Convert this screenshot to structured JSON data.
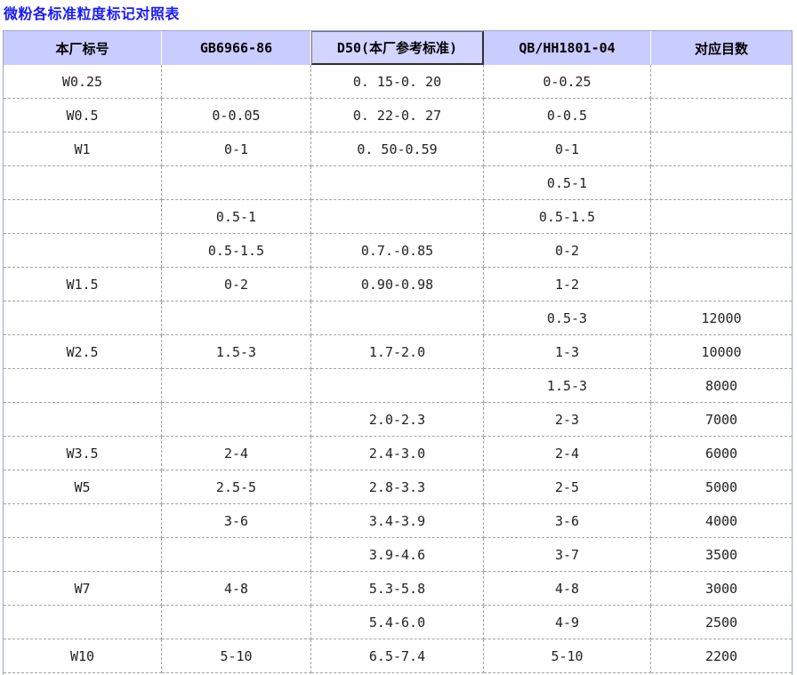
{
  "title": "微粉各标准粒度标记对照表",
  "columns": [
    "本厂标号",
    "GB6966-86",
    "D50(本厂参考标准)",
    "QB/HH1801-04",
    "对应目数"
  ],
  "rows": [
    [
      "W0.25",
      "",
      "0. 15-0. 20",
      "0-0.25",
      ""
    ],
    [
      "W0.5",
      "0-0.05",
      "0. 22-0. 27",
      "0-0.5",
      ""
    ],
    [
      "W1",
      "0-1",
      "0. 50-0.59",
      "0-1",
      ""
    ],
    [
      "",
      "",
      "",
      "0.5-1",
      ""
    ],
    [
      "",
      "0.5-1",
      "",
      "0.5-1.5",
      ""
    ],
    [
      "",
      "0.5-1.5",
      "0.7.-0.85",
      "0-2",
      ""
    ],
    [
      "W1.5",
      "0-2",
      "0.90-0.98",
      "1-2",
      ""
    ],
    [
      "",
      "",
      "",
      "0.5-3",
      "12000"
    ],
    [
      "W2.5",
      "1.5-3",
      "1.7-2.0",
      "1-3",
      "10000"
    ],
    [
      "",
      "",
      "",
      "1.5-3",
      "8000"
    ],
    [
      "",
      "",
      "2.0-2.3",
      "2-3",
      "7000"
    ],
    [
      "W3.5",
      "2-4",
      "2.4-3.0",
      "2-4",
      "6000"
    ],
    [
      "W5",
      "2.5-5",
      "2.8-3.3",
      "2-5",
      "5000"
    ],
    [
      "",
      "3-6",
      "3.4-3.9",
      "3-6",
      "4000"
    ],
    [
      "",
      "",
      "3.9-4.6",
      "3-7",
      "3500"
    ],
    [
      "W7",
      "4-8",
      "5.3-5.8",
      "4-8",
      "3000"
    ],
    [
      "",
      "",
      "5.4-6.0",
      "4-9",
      "2500"
    ],
    [
      "W10",
      "5-10",
      "6.5-7.4",
      "5-10",
      "2200"
    ]
  ]
}
